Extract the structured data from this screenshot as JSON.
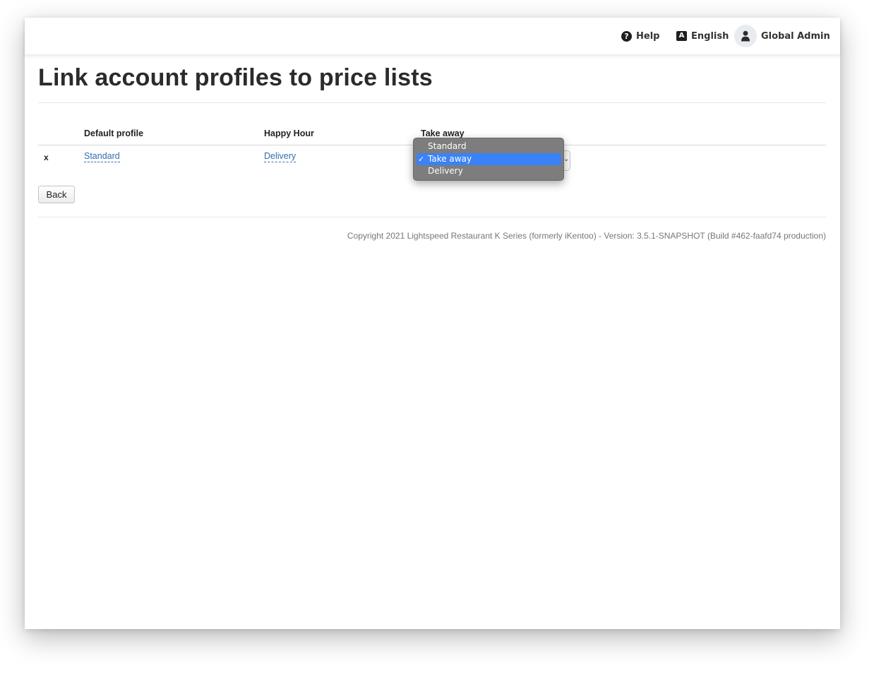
{
  "topbar": {
    "help_label": "Help",
    "help_icon": "help-circle-icon",
    "language_label": "English",
    "language_icon": "language-icon",
    "user_label": "Global Admin",
    "user_icon": "user-avatar-icon"
  },
  "page": {
    "title": "Link account profiles to price lists"
  },
  "table": {
    "columns": [
      "Default profile",
      "Happy Hour",
      "Take away"
    ],
    "rows": [
      {
        "remove_label": "x",
        "default_profile": "Standard",
        "happy_hour": "Delivery",
        "take_away": "Take away"
      }
    ]
  },
  "dropdown": {
    "options": [
      {
        "label": "Standard",
        "selected": false
      },
      {
        "label": "Take away",
        "selected": true
      },
      {
        "label": "Delivery",
        "selected": false
      }
    ],
    "check_mark": "✓"
  },
  "actions": {
    "back_label": "Back"
  },
  "footer": {
    "copyright": "Copyright 2021 Lightspeed Restaurant K Series (formerly iKentoo) - Version: 3.5.1-SNAPSHOT (Build #462-faafd74 production)"
  },
  "colors": {
    "link": "#2f6fad",
    "dropdown_bg": "#787878",
    "dropdown_selected": "#3a82f7"
  }
}
